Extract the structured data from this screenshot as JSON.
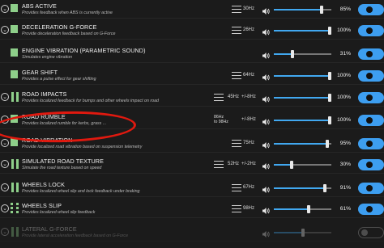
{
  "effects": [
    {
      "title": "ABS ACTIVE",
      "desc": "Provides feedback when ABS is currently active",
      "icon": "square",
      "chevron": true,
      "freq": "30Hz",
      "volume": "85%",
      "level": 0.85,
      "enabled": true
    },
    {
      "title": "DECELERATION G-FORCE",
      "desc": "Provide deceleration feedback based on G-Force",
      "icon": "square",
      "chevron": true,
      "freq": "26Hz",
      "volume": "100%",
      "level": 1.0,
      "enabled": true
    },
    {
      "title": "ENGINE VIBRATION (PARAMETRIC SOUND)",
      "desc": "Simulates engine vibration",
      "icon": "square",
      "chevron": false,
      "freq": "",
      "volume": "31%",
      "level": 0.31,
      "enabled": true
    },
    {
      "title": "GEAR SHIFT",
      "desc": "Provides a pulse effect for gear shifting",
      "icon": "square",
      "chevron": false,
      "freq": "64Hz",
      "volume": "100%",
      "level": 1.0,
      "enabled": true
    },
    {
      "title": "ROAD IMPACTS",
      "desc": "Provides localized feedback for bumps and other wheels impact on road",
      "icon": "bars",
      "chevron": true,
      "freq": "45Hz",
      "freq_extra": "+/-8Hz",
      "volume": "100%",
      "level": 1.0,
      "enabled": true
    },
    {
      "title": "ROAD RUMBLE",
      "desc": "Provides localized rumble for kerbs, grass ...",
      "icon": "square",
      "chevron": true,
      "freq_line1": "86Hz",
      "freq_line2": "to 98Hz",
      "freq_extra": "+/-8Hz",
      "volume": "100%",
      "level": 1.0,
      "enabled": true
    },
    {
      "title": "ROAD VIBRATION",
      "desc": "Provide localized road vibration based on suspension telemetry",
      "icon": "square",
      "chevron": true,
      "freq": "75Hz",
      "volume": "95%",
      "level": 0.95,
      "enabled": true
    },
    {
      "title": "SIMULATED ROAD TEXTURE",
      "desc": "Simulate the road texture based on speed",
      "icon": "bars",
      "chevron": true,
      "freq": "52Hz",
      "freq_extra": "+/-2Hz",
      "volume": "30%",
      "level": 0.3,
      "enabled": true
    },
    {
      "title": "WHEELS LOCK",
      "desc": "Provides localized wheel slip and lock feedback under braking",
      "icon": "bars",
      "chevron": true,
      "freq": "67Hz",
      "volume": "91%",
      "level": 0.91,
      "enabled": true
    },
    {
      "title": "WHEELS SLIP",
      "desc": "Provides localized wheel slip feedback",
      "icon": "dots",
      "chevron": true,
      "freq": "98Hz",
      "volume": "61%",
      "level": 0.61,
      "enabled": true
    },
    {
      "title": "LATERAL G-FORCE",
      "desc": "Provide lateral acceleration feedback based on G-Force",
      "icon": "bars",
      "chevron": true,
      "freq": "",
      "volume": "",
      "level": 0.5,
      "enabled": false
    }
  ],
  "highlight_row": "ROAD RUMBLE",
  "colors": {
    "accent": "#41a8f0",
    "toggle": "#3d9ef0",
    "effect_icon": "#8ecf8a",
    "highlight": "#e0190f",
    "background": "#1b1b1b"
  }
}
